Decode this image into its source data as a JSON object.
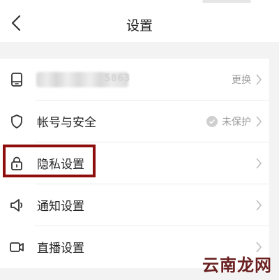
{
  "header": {
    "title": "设置"
  },
  "rows": [
    {
      "icon": "phone-icon",
      "label": "",
      "masked_suffix": "5863",
      "right_text": "更换"
    },
    {
      "icon": "shield-icon",
      "label": "帐号与安全",
      "right_text": "未保护",
      "status_icon": "check-circle-icon"
    },
    {
      "icon": "lock-icon",
      "label": "隐私设置",
      "right_text": ""
    },
    {
      "icon": "megaphone-icon",
      "label": "通知设置",
      "right_text": ""
    },
    {
      "icon": "video-camera-icon",
      "label": "直播设置",
      "right_text": ""
    }
  ],
  "watermark": "云南龙网",
  "colors": {
    "highlight": "#8e0d0d",
    "secondary_text": "#9a9a9a"
  }
}
